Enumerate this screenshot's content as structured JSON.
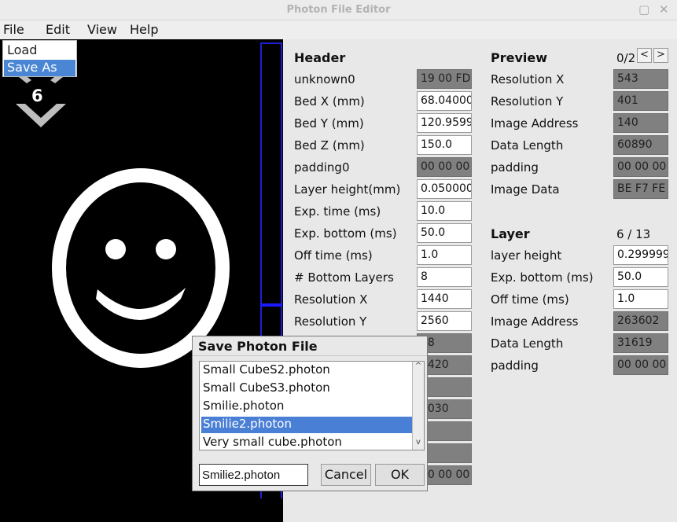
{
  "window": {
    "title": "Photon File Editor",
    "minimize_symbol": "▢",
    "close_symbol": "✕"
  },
  "menubar": {
    "items": [
      {
        "label": "File"
      },
      {
        "label": "Edit"
      },
      {
        "label": "View"
      },
      {
        "label": "Help"
      }
    ]
  },
  "file_menu": {
    "items": [
      {
        "label": "Load",
        "selected": false
      },
      {
        "label": "Save As",
        "selected": true
      }
    ]
  },
  "canvas": {
    "layer_number": "6",
    "icon_image": "smiley-face-icon"
  },
  "header": {
    "title": "Header",
    "fields": [
      {
        "label": "unknown0",
        "value": "19 00 FD",
        "readonly": true
      },
      {
        "label": "Bed X (mm)",
        "value": "68.04000",
        "readonly": false
      },
      {
        "label": "Bed Y (mm)",
        "value": "120.9599",
        "readonly": false
      },
      {
        "label": "Bed Z (mm)",
        "value": "150.0",
        "readonly": false
      },
      {
        "label": "padding0",
        "value": "00 00 00",
        "readonly": true
      },
      {
        "label": "Layer height(mm)",
        "value": "0.050000",
        "readonly": false
      },
      {
        "label": "Exp. time (ms)",
        "value": "10.0",
        "readonly": false
      },
      {
        "label": "Exp. bottom (ms)",
        "value": "50.0",
        "readonly": false
      },
      {
        "label": "Off time (ms)",
        "value": "1.0",
        "readonly": false
      },
      {
        "label": "# Bottom Layers",
        "value": "8",
        "readonly": false
      },
      {
        "label": "Resolution X",
        "value": "1440",
        "readonly": false
      },
      {
        "label": "Resolution Y",
        "value": "2560",
        "readonly": false
      },
      {
        "label": "",
        "value": "08",
        "readonly": true
      },
      {
        "label": "",
        "value": "3420",
        "readonly": true
      },
      {
        "label": "",
        "value": "3",
        "readonly": true
      },
      {
        "label": "",
        "value": "1030",
        "readonly": true
      },
      {
        "label": "",
        "value": "",
        "readonly": true
      },
      {
        "label": "",
        "value": "",
        "readonly": true
      },
      {
        "label": "",
        "value": "00 00 00",
        "readonly": true
      }
    ]
  },
  "preview": {
    "title": "Preview",
    "count": "0/2",
    "prev_label": "<",
    "next_label": ">",
    "fields": [
      {
        "label": "Resolution X",
        "value": "543",
        "readonly": true
      },
      {
        "label": "Resolution Y",
        "value": "401",
        "readonly": true
      },
      {
        "label": "Image Address",
        "value": "140",
        "readonly": true
      },
      {
        "label": "Data Length",
        "value": "60890",
        "readonly": true
      },
      {
        "label": "padding",
        "value": "00 00 00",
        "readonly": true
      },
      {
        "label": "Image Data",
        "value": "BE F7 FE",
        "readonly": true
      }
    ]
  },
  "layer": {
    "title": "Layer",
    "count": "6 / 13",
    "fields": [
      {
        "label": "layer height",
        "value": "0.299999",
        "readonly": false
      },
      {
        "label": "Exp. bottom (ms)",
        "value": "50.0",
        "readonly": false
      },
      {
        "label": "Off time (ms)",
        "value": "1.0",
        "readonly": false
      },
      {
        "label": "Image Address",
        "value": "263602",
        "readonly": true
      },
      {
        "label": "Data Length",
        "value": "31619",
        "readonly": true
      },
      {
        "label": "padding",
        "value": "00 00 00",
        "readonly": true
      }
    ]
  },
  "save_dialog": {
    "title": "Save Photon File",
    "files": [
      {
        "name": "Small CubeS2.photon",
        "selected": false
      },
      {
        "name": "Small CubeS3.photon",
        "selected": false
      },
      {
        "name": "Smilie.photon",
        "selected": false
      },
      {
        "name": "Smilie2.photon",
        "selected": true
      },
      {
        "name": "Very small cube.photon",
        "selected": false
      }
    ],
    "scroll_up_symbol": "^",
    "scroll_down_symbol": "v",
    "filename_value": "Smilie2.photon",
    "cancel_label": "Cancel",
    "ok_label": "OK"
  }
}
